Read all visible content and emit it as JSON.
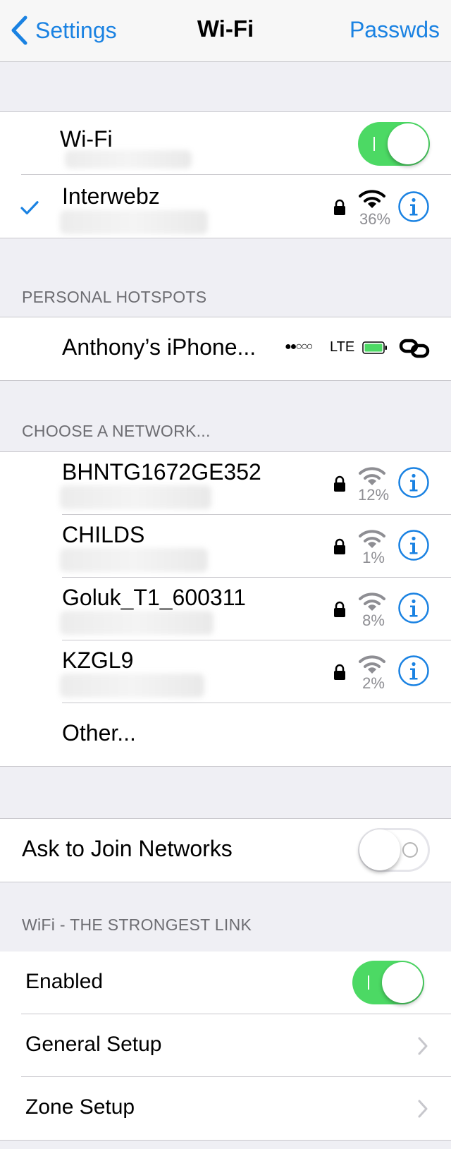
{
  "nav": {
    "back_label": "Settings",
    "title": "Wi-Fi",
    "right_label": "Passwds"
  },
  "wifi_toggle": {
    "label": "Wi-Fi",
    "state": "on"
  },
  "connected": {
    "name": "Interwebz",
    "strength": "36%",
    "secured": true,
    "selected": true
  },
  "hotspots": {
    "header": "PERSONAL HOTSPOTS",
    "items": [
      {
        "name": "Anthony’s iPhone...",
        "signal": "●●○○○",
        "network": "LTE"
      }
    ]
  },
  "choose": {
    "header": "CHOOSE A NETWORK...",
    "networks": [
      {
        "name": "BHNTG1672GE352",
        "strength": "12%"
      },
      {
        "name": "CHILDS",
        "strength": "1%"
      },
      {
        "name": "Goluk_T1_600311",
        "strength": "8%"
      },
      {
        "name": "KZGL9",
        "strength": "2%"
      }
    ],
    "other_label": "Other..."
  },
  "ask_join": {
    "label": "Ask to Join Networks",
    "state": "off"
  },
  "strongest": {
    "header": "WiFi - THE STRONGEST LINK",
    "enabled_label": "Enabled",
    "enabled_state": "on",
    "general_label": "General Setup",
    "zone_label": "Zone Setup"
  },
  "colors": {
    "accent": "#1a82e2",
    "switch_on": "#4cd964",
    "battery": "#4cd964",
    "background": "#efeff4"
  },
  "icons": {
    "checkmark": "checkmark-icon",
    "lock": "lock-icon",
    "wifi": "wifi-signal-icon",
    "info": "info-icon",
    "link": "link-icon",
    "chevron": "chevron-right-icon"
  }
}
